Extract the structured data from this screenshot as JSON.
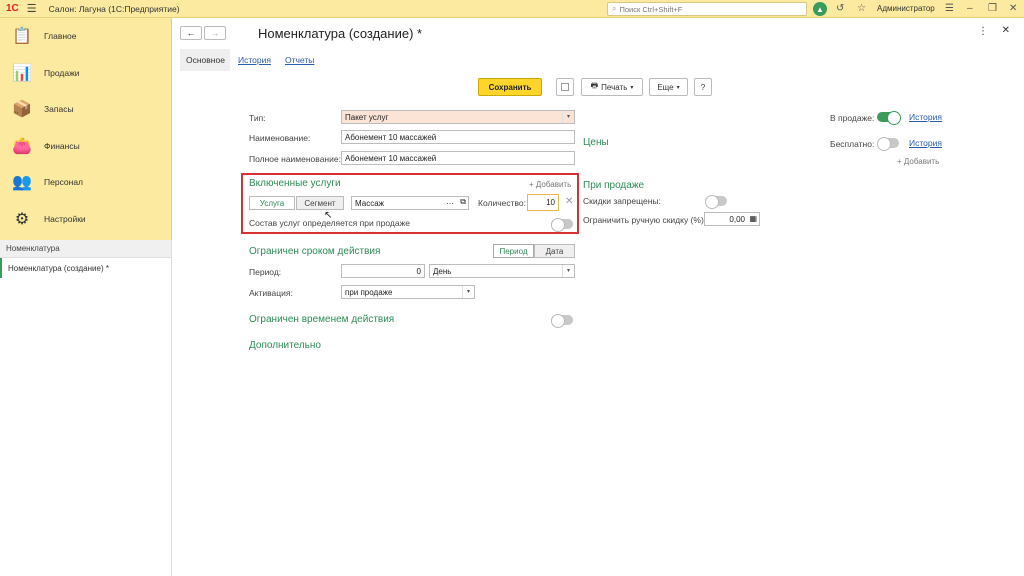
{
  "app": {
    "logo": "1С",
    "title": "Салон: Лагуна  (1С:Предприятие)",
    "search_placeholder": "Поиск Ctrl+Shift+F",
    "user": "Администратор"
  },
  "sidebar": {
    "items": [
      {
        "label": "Главное",
        "icon": "clipboard-icon"
      },
      {
        "label": "Продажи",
        "icon": "chart-icon"
      },
      {
        "label": "Запасы",
        "icon": "boxes-icon"
      },
      {
        "label": "Финансы",
        "icon": "wallet-icon"
      },
      {
        "label": "Персонал",
        "icon": "people-icon"
      },
      {
        "label": "Настройки",
        "icon": "gear-icon"
      }
    ],
    "open_header": "Номенклатура",
    "open_item": "Номенклатура (создание) *"
  },
  "form": {
    "title": "Номенклатура (создание) *",
    "tabs": [
      "Основное",
      "История",
      "Отчеты"
    ],
    "toolbar": {
      "save": "Сохранить",
      "print": "Печать",
      "more": "Еще",
      "help": "?"
    },
    "fields": {
      "type_label": "Тип:",
      "type_value": "Пакет услуг",
      "name_label": "Наименование:",
      "name_value": "Абонемент 10 массажей",
      "fullname_label": "Полное наименование:",
      "fullname_value": "Абонемент 10 массажей"
    },
    "included": {
      "title": "Включенные услуги",
      "add": "+ Добавить",
      "seg_service": "Услуга",
      "seg_segment": "Сегмент",
      "service_value": "Массаж",
      "qty_label": "Количество:",
      "qty_value": "10",
      "composition_label": "Состав услуг определяется при продаже"
    },
    "duration": {
      "title": "Ограничен сроком действия",
      "seg_period": "Период",
      "seg_date": "Дата",
      "period_label": "Период:",
      "period_value": "0",
      "period_unit": "День",
      "activation_label": "Активация:",
      "activation_value": "при продаже"
    },
    "time_limit_title": "Ограничен временем действия",
    "additional_title": "Дополнительно",
    "right": {
      "on_sale_label": "В продаже:",
      "history": "История",
      "free_label": "Бесплатно:",
      "history2": "История",
      "add": "+ Добавить",
      "prices_title": "Цены",
      "at_sale_title": "При продаже",
      "discounts_label": "Скидки запрещены:",
      "limit_label": "Ограничить ручную скидку (%):",
      "limit_value": "0,00"
    }
  }
}
